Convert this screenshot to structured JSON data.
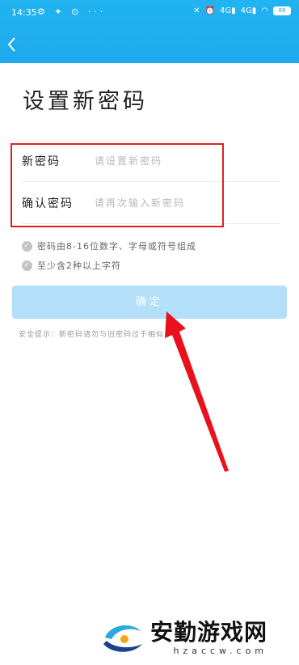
{
  "status_bar": {
    "time": "14:35",
    "left_icons": "⚙ ✦ ⊙ ···",
    "network_1": "4G",
    "network_2": "4G",
    "battery": "88"
  },
  "header": {
    "back_icon": "chevron-left-icon"
  },
  "page": {
    "title": "设置新密码"
  },
  "form": {
    "new_password": {
      "label": "新密码",
      "placeholder": "请设置新密码"
    },
    "confirm_password": {
      "label": "确认密码",
      "placeholder": "请再次输入新密码"
    }
  },
  "rules": [
    "密码由8-16位数字、字母或符号组成",
    "至少含2种以上字符"
  ],
  "confirm_button": {
    "label": "确定"
  },
  "tip": "安全提示：新密码请勿与旧密码过于相似",
  "watermark": {
    "name": "安勤游戏网",
    "url": "hzaccw.com"
  },
  "colors": {
    "header": "#1ea9ee",
    "button": "#b3dff8",
    "highlight": "#e02020",
    "arrow": "#e8121c"
  }
}
